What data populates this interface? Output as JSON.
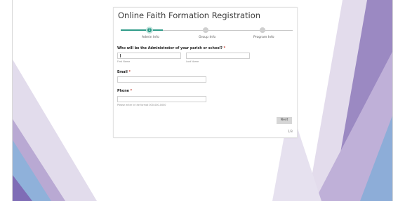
{
  "form": {
    "title": "Online Faith Formation Registration",
    "steps": [
      {
        "number": "1",
        "label": "Admin Info"
      },
      {
        "number": "2",
        "label": "Group Info"
      },
      {
        "number": "3",
        "label": "Program Info"
      }
    ],
    "current_step": 1,
    "questions": {
      "admin": {
        "label": "Who will be the Administrator of your parish or school?",
        "required": "*"
      },
      "email": {
        "label": "Email",
        "required": "*"
      },
      "phone": {
        "label": "Phone",
        "required": "*"
      }
    },
    "fields": {
      "first_name_hint": "First Name",
      "last_name_hint": "Last Name",
      "phone_hint": "Please enter in the format 000-000-0000"
    },
    "next_label": "Next",
    "page_count": "1/3"
  },
  "colors": {
    "accent": "#2f9b89",
    "required": "#c0392b"
  }
}
